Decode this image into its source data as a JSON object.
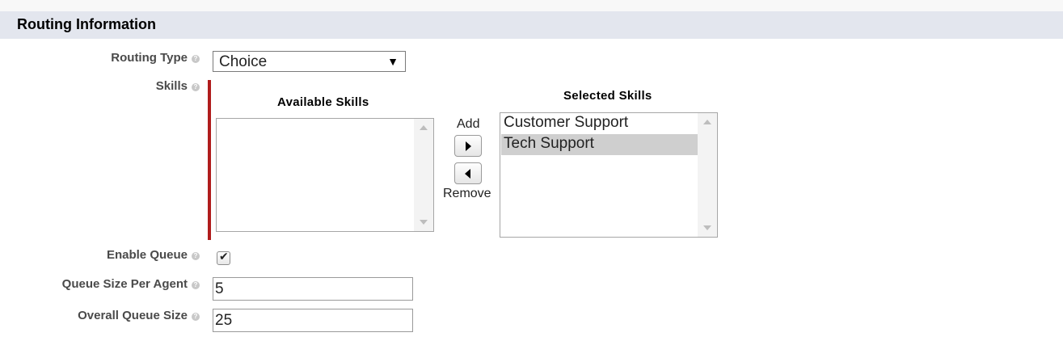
{
  "section": {
    "title": "Routing Information"
  },
  "routing_type": {
    "label": "Routing Type",
    "value": "Choice"
  },
  "skills": {
    "label": "Skills",
    "available_header": "Available Skills",
    "selected_header": "Selected Skills",
    "available_options": [],
    "selected_options": [
      {
        "label": "Customer Support",
        "selected": false
      },
      {
        "label": "Tech Support",
        "selected": true
      }
    ],
    "add_label": "Add",
    "remove_label": "Remove"
  },
  "enable_queue": {
    "label": "Enable Queue",
    "checked": true
  },
  "queue_size_per_agent": {
    "label": "Queue Size Per Agent",
    "value": "5"
  },
  "overall_queue_size": {
    "label": "Overall Queue Size",
    "value": "25"
  },
  "colors": {
    "header_bg": "#e3e6ee",
    "required_bar": "#b01c1c",
    "selected_option_bg": "#cfcfcf"
  }
}
